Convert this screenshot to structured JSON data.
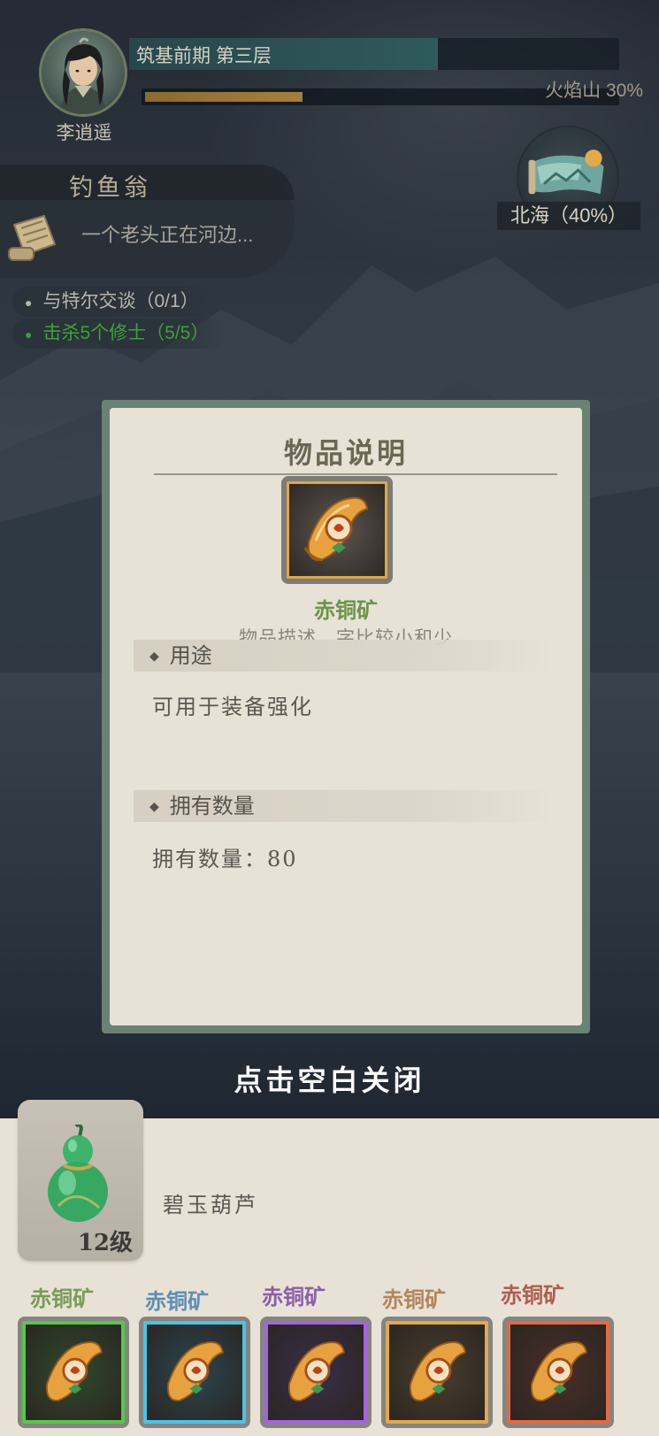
{
  "player": {
    "name": "李逍遥",
    "realm": "筑基前期 第三层",
    "realm_progress": 0.63,
    "location_progress_text": "火焰山  30%",
    "location_progress": 0.33
  },
  "map": {
    "label": "北海（40%）"
  },
  "quest": {
    "title": "钓鱼翁",
    "description": "一个老头正在河边...",
    "objectives": [
      {
        "text": "与特尔交谈（0/1）",
        "color": "#b8b5ab",
        "complete": false
      },
      {
        "text": "击杀5个修士（5/5）",
        "color": "#3fa03a",
        "complete": true
      }
    ]
  },
  "item_modal": {
    "title": "物品说明",
    "item_name": "赤铜矿",
    "item_name_color": "#6c9448",
    "item_description": "物品描述，字比较小和少",
    "sections": {
      "usage_heading": "用途",
      "usage_text": "可用于装备强化",
      "owned_heading": "拥有数量",
      "owned_text": "拥有数量：80"
    },
    "close_hint": "点击空白关闭"
  },
  "inventory": {
    "featured": {
      "name": "碧玉葫芦",
      "level": "12级",
      "icon": "jade-gourd-icon"
    },
    "slots": [
      {
        "label": "赤铜矿",
        "label_color": "#7a9a5a",
        "border_color": "#57c848",
        "bg": "#2f4a2c",
        "icon": "scroll-icon"
      },
      {
        "label": "赤铜矿",
        "label_color": "#5c8fb2",
        "border_color": "#4cc3e6",
        "bg": "#2b4650",
        "icon": "scroll-icon"
      },
      {
        "label": "赤铜矿",
        "label_color": "#8a5fa8",
        "border_color": "#a663e0",
        "bg": "#3a2e4a",
        "icon": "scroll-icon"
      },
      {
        "label": "赤铜矿",
        "label_color": "#b2865a",
        "border_color": "#e4a948",
        "bg": "#4a3e2c",
        "icon": "scroll-icon"
      },
      {
        "label": "赤铜矿",
        "label_color": "#b05c4e",
        "border_color": "#e8683e",
        "bg": "#4a2e28",
        "icon": "scroll-icon"
      }
    ]
  }
}
